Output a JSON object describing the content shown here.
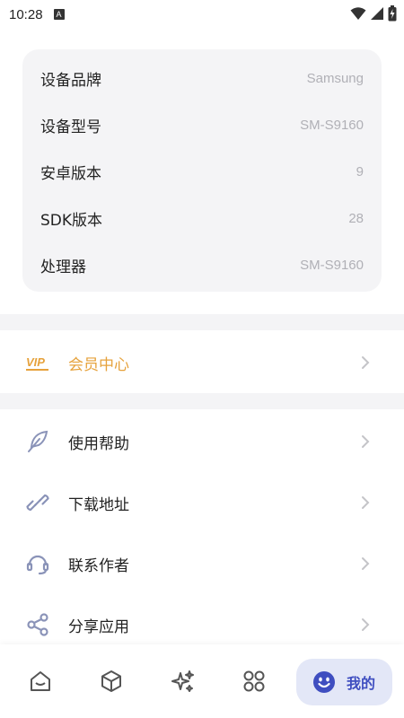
{
  "status_bar": {
    "time": "10:28",
    "notification_glyph": "A"
  },
  "device_info": [
    {
      "label": "设备品牌",
      "value": "Samsung"
    },
    {
      "label": "设备型号",
      "value": "SM-S9160"
    },
    {
      "label": "安卓版本",
      "value": "9"
    },
    {
      "label": "SDK版本",
      "value": "28"
    },
    {
      "label": "处理器",
      "value": "SM-S9160"
    }
  ],
  "vip": {
    "badge": "VIP",
    "label": "会员中心"
  },
  "menu": [
    {
      "label": "使用帮助",
      "icon": "feather-icon"
    },
    {
      "label": "下载地址",
      "icon": "link-icon"
    },
    {
      "label": "联系作者",
      "icon": "headset-icon"
    },
    {
      "label": "分享应用",
      "icon": "share-icon"
    }
  ],
  "bottom_nav": {
    "items": [
      "home-icon",
      "cube-icon",
      "sparkle-icon",
      "apps-icon"
    ],
    "active_label": "我的",
    "active_icon": "smile-icon"
  },
  "colors": {
    "accent": "#3f4ec0",
    "vip": "#e6a23c",
    "card_bg": "#f4f4f6",
    "icon": "#8a93b8"
  }
}
